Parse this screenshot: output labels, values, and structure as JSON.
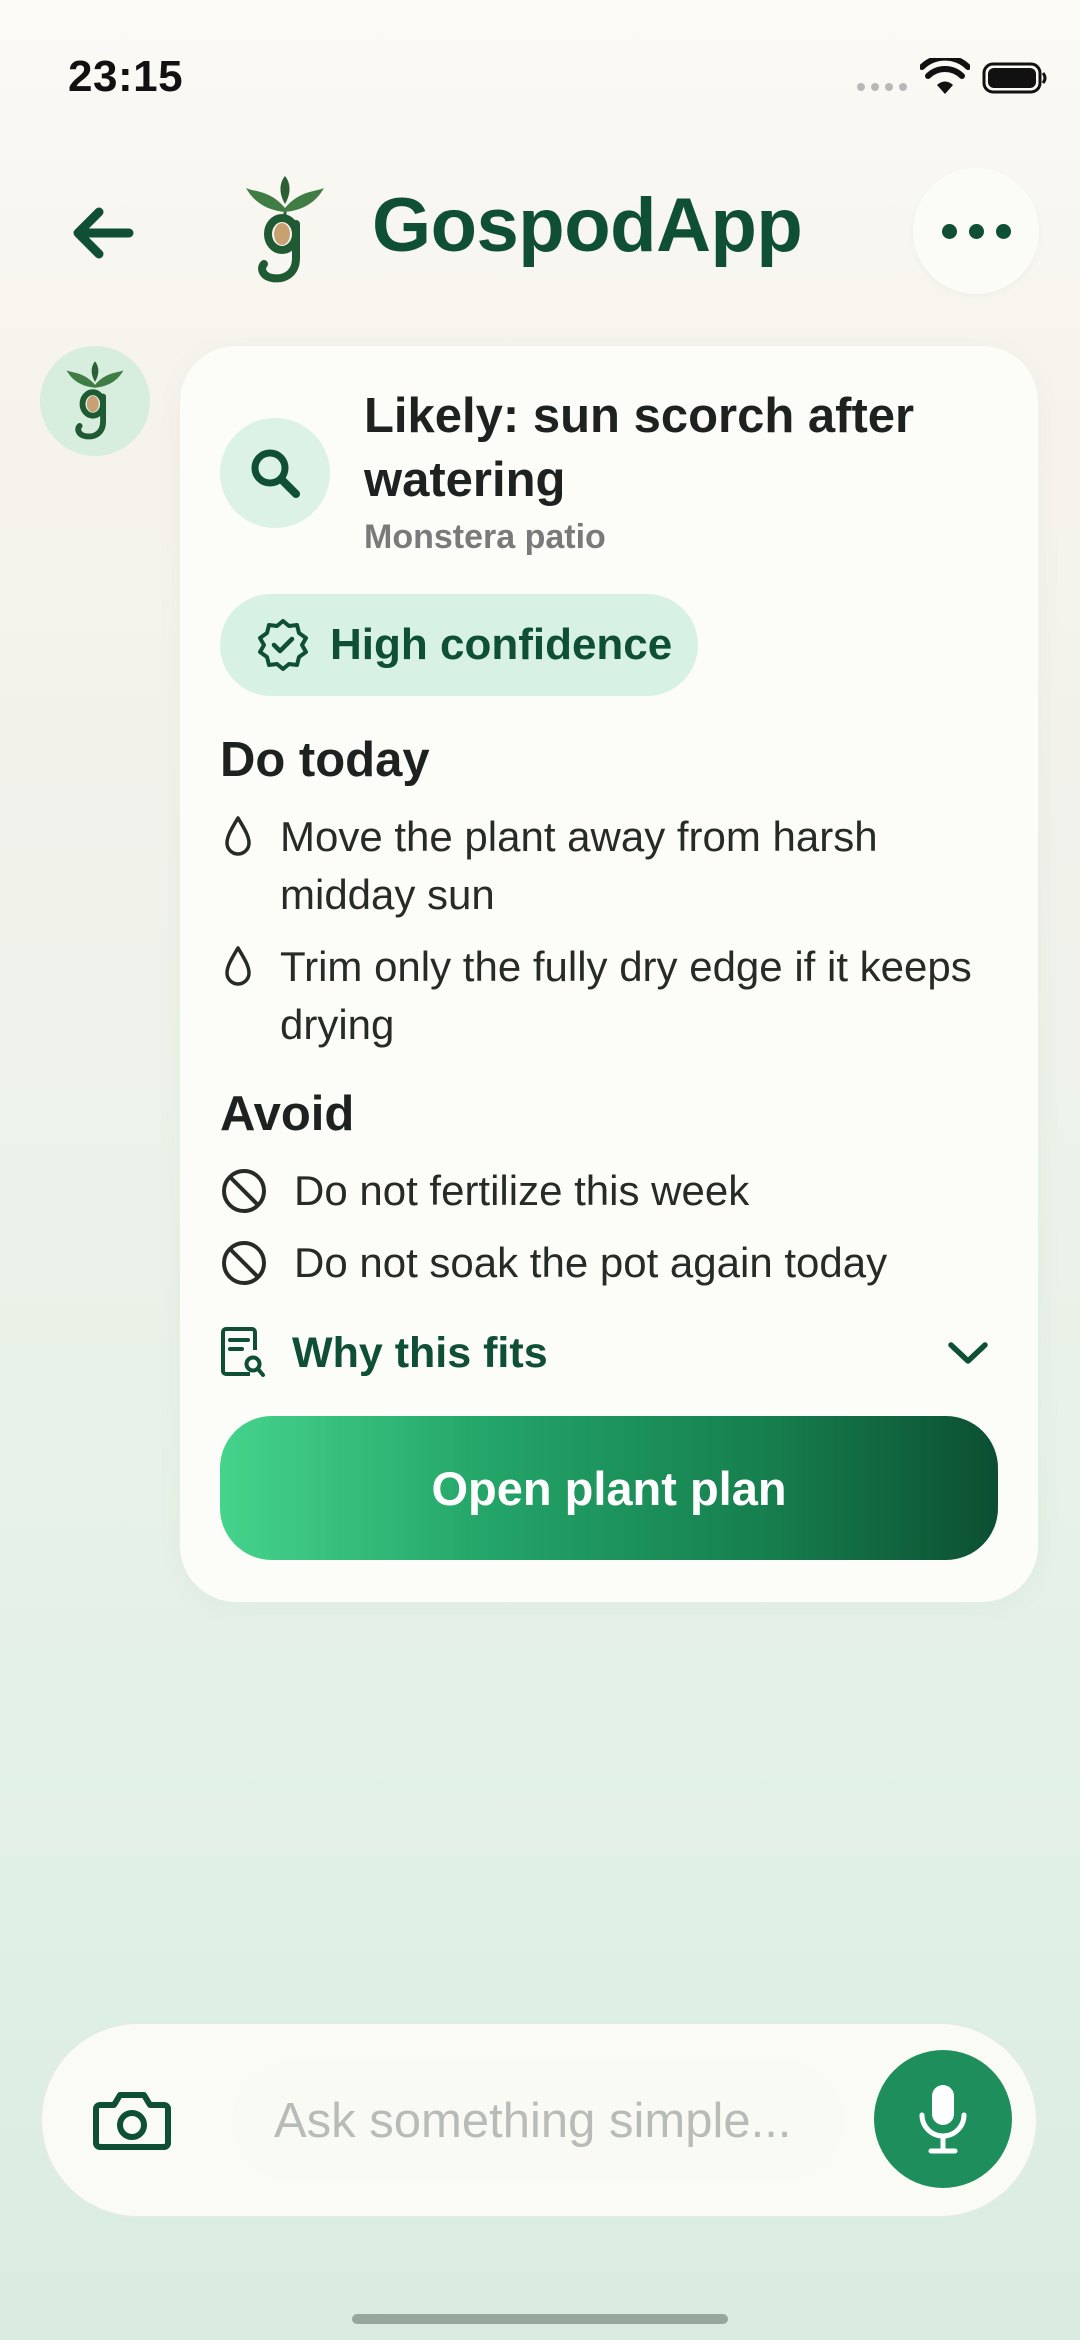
{
  "status_bar": {
    "time": "23:15"
  },
  "header": {
    "title": "GospodApp"
  },
  "card": {
    "title": "Likely: sun scorch after watering",
    "subtitle": "Monstera patio",
    "confidence": "High confidence",
    "do_today": {
      "heading": "Do today",
      "items": [
        {
          "text": "Move the plant away from harsh midday sun"
        },
        {
          "text": "Trim only the fully dry edge if it keeps drying"
        }
      ]
    },
    "avoid": {
      "heading": "Avoid",
      "items": [
        {
          "text": "Do not fertilize this week"
        },
        {
          "text": "Do not soak the pot again today"
        }
      ]
    },
    "why_label": "Why this fits",
    "cta_label": "Open plant plan"
  },
  "input_bar": {
    "placeholder": "Ask something simple..."
  },
  "colors": {
    "brand_dark": "#0f4f33",
    "accent_green": "#1e8f5c",
    "badge_bg": "#d7f2e2"
  },
  "icons": {
    "back": "arrow-left-icon",
    "more": "more-horizontal-icon",
    "search": "search-icon",
    "confidence": "verified-badge-icon",
    "do_item": "droplet-icon",
    "avoid_item": "ban-icon",
    "why": "document-search-icon",
    "expand": "chevron-down-icon",
    "camera": "camera-icon",
    "mic": "microphone-icon"
  }
}
